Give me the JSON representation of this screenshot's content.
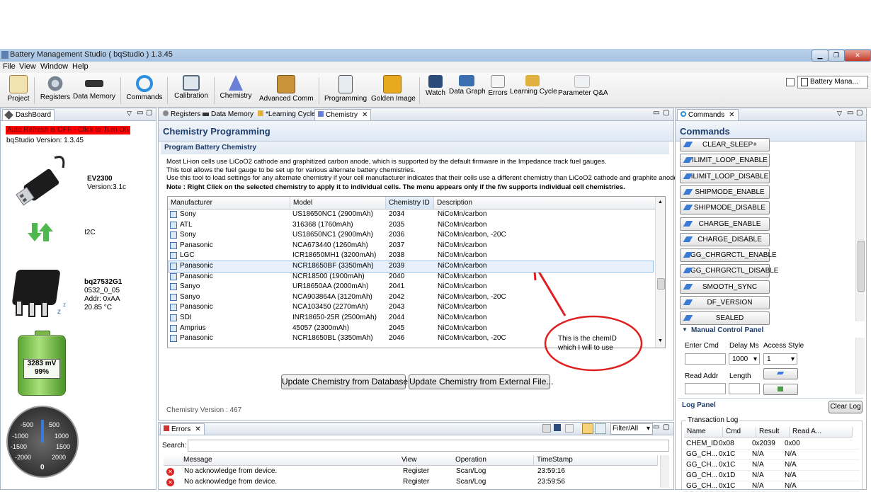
{
  "window": {
    "title": "Battery Management Studio ( bqStudio ) 1.3.45"
  },
  "menu": [
    "File",
    "View",
    "Window",
    "Help"
  ],
  "toolbar": {
    "items": [
      "Project",
      "Registers",
      "Data Memory",
      "Commands",
      "Calibration",
      "Chemistry",
      "Advanced Comm",
      "Programming",
      "Golden Image",
      "Watch",
      "Data Graph",
      "Errors",
      "Learning Cycle",
      "Parameter Q&A"
    ],
    "perspective": "Battery Mana..."
  },
  "dashboard": {
    "tab": "DashBoard",
    "auto_refresh": "Auto Refresh is OFF - Click to Turn On",
    "version": "bqStudio Version:  1.3.45",
    "adapter_name": "EV2300",
    "adapter_version": "Version:3.1c",
    "bus": "I2C",
    "device_name": "bq27532G1",
    "device_fw": "0532_0_05",
    "device_addr": "Addr: 0xAA",
    "device_temp": "20.85 °C",
    "voltage": "3283 mV",
    "soc": "99%",
    "soc_fraction": 0.99,
    "gauge_labels": [
      "-500",
      "500",
      "-1000",
      "1000",
      "-1500",
      "1500",
      "-2000",
      "2000"
    ],
    "gauge_value": "0"
  },
  "editor": {
    "tabs": [
      "Registers",
      "Data Memory",
      "*Learning Cycle",
      "Chemistry"
    ],
    "title": "Chemistry Programming",
    "subtitle": "Program Battery Chemistry",
    "desc1": "Most Li-ion cells use LiCoO2 cathode and graphitized carbon anode, which is supported by the default firmware in the Impedance track fuel gauges.",
    "desc2": "This tool allows the fuel gauge to be set up for various alternate battery chemistries.",
    "desc3": "Use this tool to load settings for any alternate chemistry if your cell manufacturer indicates that their cells use a different chemistry than LiCoO2 cathode and graphite anode.",
    "note": "Note : Right Click on the selected chemistry to apply it to individual cells. The menu appears only if the f/w supports individual cell chemistries.",
    "columns": [
      "Manufacturer",
      "Model",
      "Chemistry ID",
      "Description"
    ],
    "rows": [
      [
        "Sony",
        "US18650NC1 (2900mAh)",
        "2034",
        "NiCoMn/carbon"
      ],
      [
        "ATL",
        "316368 (1760mAh)",
        "2035",
        "NiCoMn/carbon"
      ],
      [
        "Sony",
        "US18650NC1 (2900mAh)",
        "2036",
        "NiCoMn/carbon, -20C"
      ],
      [
        "Panasonic",
        "NCA673440 (1260mAh)",
        "2037",
        "NiCoMn/carbon"
      ],
      [
        "LGC",
        "ICR18650MH1 (3200mAh)",
        "2038",
        "NiCoMn/carbon"
      ],
      [
        "Panasonic",
        "NCR18650BF (3350mAh)",
        "2039",
        "NiCoMn/carbon"
      ],
      [
        "Panasonic",
        "NCR18500 (1900mAh)",
        "2040",
        "NiCoMn/carbon"
      ],
      [
        "Sanyo",
        "UR18650AA (2000mAh)",
        "2041",
        "NiCoMn/carbon"
      ],
      [
        "Sanyo",
        "NCA903864A (3120mAh)",
        "2042",
        "NiCoMn/carbon, -20C"
      ],
      [
        "Panasonic",
        "NCA103450 (2270mAh)",
        "2043",
        "NiCoMn/carbon"
      ],
      [
        "SDI",
        "INR18650-25R (2500mAh)",
        "2044",
        "NiCoMn/carbon"
      ],
      [
        "Amprius",
        "45057 (2300mAh)",
        "2045",
        "NiCoMn/carbon"
      ],
      [
        "Panasonic",
        "NCR18650BL (3350mAh)",
        "2046",
        "NiCoMn/carbon, -20C"
      ]
    ],
    "selected_index": 5,
    "btn_update_db": "Update Chemistry from Database",
    "btn_update_file": "Update Chemistry from External File...",
    "chem_version": "Chemistry Version : 467",
    "annotation": "This is the chemID which I will to use"
  },
  "errors": {
    "tab": "Errors",
    "filter": "Filter/All",
    "search_label": "Search:",
    "columns": [
      "Message",
      "View",
      "Operation",
      "TimeStamp"
    ],
    "rows": [
      [
        "No acknowledge from device.",
        "Register",
        "Scan/Log",
        "23:59:16"
      ],
      [
        "No acknowledge from device.",
        "Register",
        "Scan/Log",
        "23:59:56"
      ]
    ]
  },
  "commands": {
    "tab": "Commands",
    "title": "Commands",
    "buttons": [
      "CLEAR_SLEEP+",
      "ILIMIT_LOOP_ENABLE",
      "ILIMIT_LOOP_DISABLE",
      "SHIPMODE_ENABLE",
      "SHIPMODE_DISABLE",
      "CHARGE_ENABLE",
      "CHARGE_DISABLE",
      "GG_CHRGRCTL_ENABLE",
      "GG_CHRGRCTL_DISABLE",
      "SMOOTH_SYNC",
      "DF_VERSION",
      "SEALED"
    ],
    "manual_title": "Manual Control Panel",
    "enter_cmd": "Enter Cmd",
    "delay_ms": "Delay Ms",
    "access_style": "Access Style",
    "delay_value": "1000",
    "access_value": "1",
    "read_addr": "Read Addr",
    "length": "Length",
    "log_panel": "Log Panel",
    "clear_log": "Clear Log",
    "transaction_log": "Transaction Log",
    "log_columns": [
      "Name",
      "Cmd",
      "Result",
      "Read A..."
    ],
    "log_rows": [
      [
        "CHEM_ID",
        "0x08",
        "0x2039",
        "0x00"
      ],
      [
        "GG_CH...",
        "0x1C",
        "N/A",
        "N/A"
      ],
      [
        "GG_CH...",
        "0x1C",
        "N/A",
        "N/A"
      ],
      [
        "GG_CH...",
        "0x1D",
        "N/A",
        "N/A"
      ],
      [
        "GG_CH...",
        "0x1C",
        "N/A",
        "N/A"
      ]
    ]
  }
}
